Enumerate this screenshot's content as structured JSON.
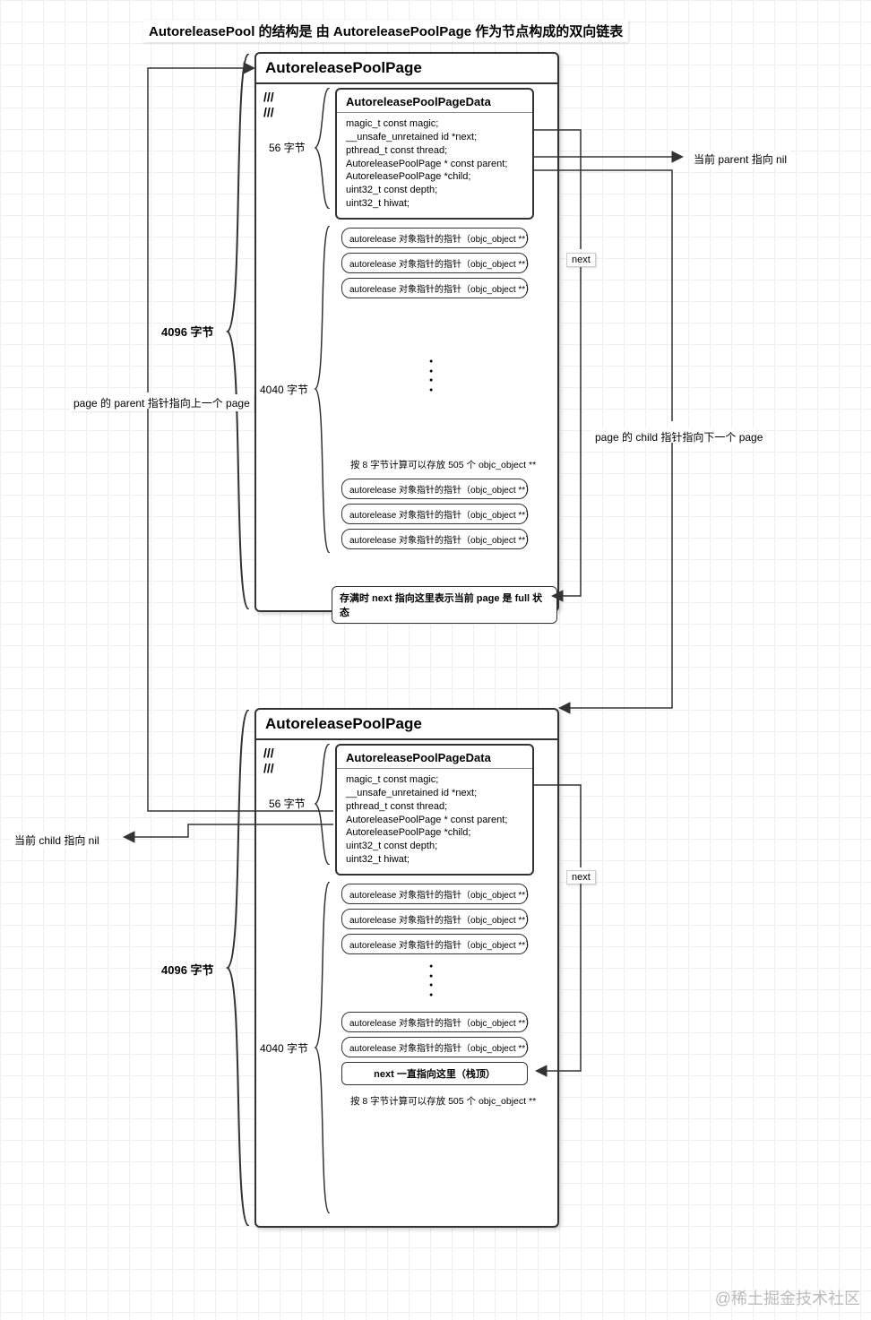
{
  "title": "AutoreleasePool 的结构是 由 AutoreleasePoolPage 作为节点构成的双向链表",
  "watermark": "@稀土掘金技术社区",
  "page_header": "AutoreleasePoolPage",
  "data_header": "AutoreleasePoolPageData",
  "slashes": "///\n///",
  "fields": {
    "f1": "magic_t const magic;",
    "f2": "__unsafe_unretained id *next;",
    "f3": "pthread_t const thread;",
    "f4": "AutoreleasePoolPage * const parent;",
    "f5": "AutoreleasePoolPage *child;",
    "f6": "uint32_t const depth;",
    "f7": "uint32_t hiwat;"
  },
  "ptr_text": "autorelease 对象指针的指针（objc_object **）",
  "capacity_note": "按 8 字节计算可以存放 505 个 objc_object **",
  "full_note": "存满时 next 指向这里表示当前 page 是 full 状态",
  "next_top_note": "next 一直指向这里（栈顶）",
  "size_56": "56 字节",
  "size_4040": "4040 字节",
  "size_4096": "4096 字节",
  "ext": {
    "parent_nil": "当前 parent 指向 nil",
    "child_next": "page 的 child 指针指向下一个 page",
    "parent_prev": "page 的 parent 指针指向上一个 page",
    "child_nil": "当前 child 指向 nil",
    "next": "next"
  }
}
